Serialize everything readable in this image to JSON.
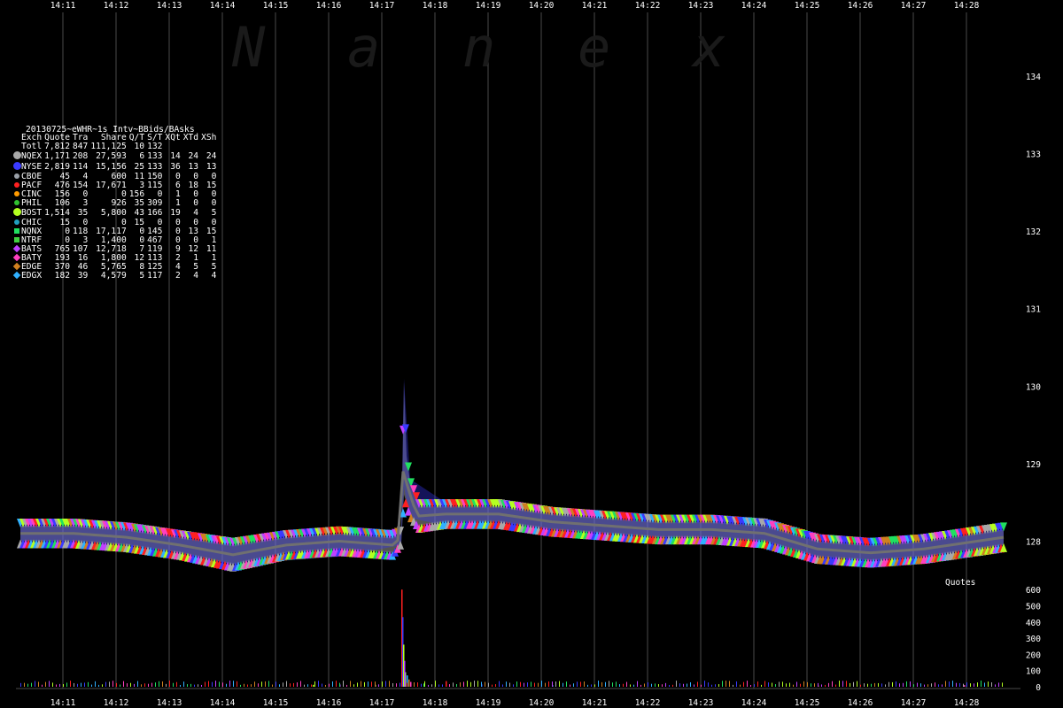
{
  "watermark": [
    "N",
    "a",
    "n",
    "e",
    "x"
  ],
  "legend": {
    "title": "20130725~eWHR~1s Intv~BBids/BAsks",
    "columns": [
      "Exch",
      "Quote",
      "Tra",
      "Share",
      "Q/T",
      "S/T",
      "XQt",
      "XTd",
      "XSh"
    ],
    "total": {
      "exch": "Totl",
      "quote": "7,812",
      "tra": "847",
      "share": "111,125",
      "qt": "10",
      "st": "132",
      "xqt": "",
      "xtd": "",
      "xsh": ""
    },
    "rows": [
      {
        "exch": "NQEX",
        "quote": "1,171",
        "tra": "208",
        "share": "27,593",
        "qt": "6",
        "st": "133",
        "xqt": "14",
        "xtd": "24",
        "xsh": "24",
        "color": "#a8a8a8",
        "marker": "dot-big"
      },
      {
        "exch": "NYSE",
        "quote": "2,819",
        "tra": "114",
        "share": "15,156",
        "qt": "25",
        "st": "133",
        "xqt": "36",
        "xtd": "13",
        "xsh": "13",
        "color": "#3a3aff",
        "marker": "dot-big"
      },
      {
        "exch": "CBOE",
        "quote": "45",
        "tra": "4",
        "share": "600",
        "qt": "11",
        "st": "150",
        "xqt": "0",
        "xtd": "0",
        "xsh": "0",
        "color": "#9aa0a8",
        "marker": "dot"
      },
      {
        "exch": "PACF",
        "quote": "476",
        "tra": "154",
        "share": "17,671",
        "qt": "3",
        "st": "115",
        "xqt": "6",
        "xtd": "18",
        "xsh": "15",
        "color": "#ff2020",
        "marker": "dot"
      },
      {
        "exch": "CINC",
        "quote": "156",
        "tra": "0",
        "share": "0",
        "qt": "156",
        "st": "0",
        "xqt": "1",
        "xtd": "0",
        "xsh": "0",
        "color": "#ff9a00",
        "marker": "dot"
      },
      {
        "exch": "PHIL",
        "quote": "106",
        "tra": "3",
        "share": "926",
        "qt": "35",
        "st": "309",
        "xqt": "1",
        "xtd": "0",
        "xsh": "0",
        "color": "#30c030",
        "marker": "dot"
      },
      {
        "exch": "BOST",
        "quote": "1,514",
        "tra": "35",
        "share": "5,800",
        "qt": "43",
        "st": "166",
        "xqt": "19",
        "xtd": "4",
        "xsh": "5",
        "color": "#b4ff20",
        "marker": "dot-big"
      },
      {
        "exch": "CHIC",
        "quote": "15",
        "tra": "0",
        "share": "0",
        "qt": "15",
        "st": "0",
        "xqt": "0",
        "xtd": "0",
        "xsh": "0",
        "color": "#20a0c0",
        "marker": "dot"
      },
      {
        "exch": "NQNX",
        "quote": "0",
        "tra": "118",
        "share": "17,117",
        "qt": "0",
        "st": "145",
        "xqt": "0",
        "xtd": "13",
        "xsh": "15",
        "color": "#20e060",
        "marker": "square"
      },
      {
        "exch": "NTRF",
        "quote": "0",
        "tra": "3",
        "share": "1,400",
        "qt": "0",
        "st": "467",
        "xqt": "0",
        "xtd": "0",
        "xsh": "1",
        "color": "#40d040",
        "marker": "square"
      },
      {
        "exch": "BATS",
        "quote": "765",
        "tra": "107",
        "share": "12,718",
        "qt": "7",
        "st": "119",
        "xqt": "9",
        "xtd": "12",
        "xsh": "11",
        "color": "#c040ff",
        "marker": "diamond"
      },
      {
        "exch": "BATY",
        "quote": "193",
        "tra": "16",
        "share": "1,800",
        "qt": "12",
        "st": "113",
        "xqt": "2",
        "xtd": "1",
        "xsh": "1",
        "color": "#ff40c0",
        "marker": "diamond"
      },
      {
        "exch": "EDGE",
        "quote": "370",
        "tra": "46",
        "share": "5,765",
        "qt": "8",
        "st": "125",
        "xqt": "4",
        "xtd": "5",
        "xsh": "5",
        "color": "#d08020",
        "marker": "diamond"
      },
      {
        "exch": "EDGX",
        "quote": "182",
        "tra": "39",
        "share": "4,579",
        "qt": "5",
        "st": "117",
        "xqt": "2",
        "xtd": "4",
        "xsh": "4",
        "color": "#30b0ff",
        "marker": "diamond"
      }
    ]
  },
  "colors": {
    "background": "#000000",
    "grid": "#4a4a4a",
    "text": "#ffffff",
    "nbbo": "#707070"
  },
  "chart_data": [
    {
      "type": "line",
      "x_ticks": [
        "14:11",
        "14:12",
        "14:13",
        "14:14",
        "14:15",
        "14:16",
        "14:17",
        "14:18",
        "14:19",
        "14:20",
        "14:21",
        "14:22",
        "14:23",
        "14:24",
        "14:25",
        "14:26",
        "14:27",
        "14:28"
      ],
      "xlim": [
        "14:10:12",
        "14:28:54"
      ],
      "y_ticks": [
        128,
        129,
        130,
        131,
        132,
        133,
        134
      ],
      "ylim": [
        127.6,
        134.3
      ],
      "grid": true,
      "series": [
        {
          "name": "NQEX",
          "color": "#a8a8a8",
          "bid": [
            [
              0,
              128.0
            ],
            [
              60,
              128.0
            ],
            [
              120,
              127.95
            ],
            [
              180,
              127.85
            ],
            [
              240,
              127.7
            ],
            [
              300,
              127.85
            ],
            [
              360,
              127.9
            ],
            [
              420,
              127.85
            ],
            [
              430,
              128.0
            ],
            [
              433,
              128.6
            ],
            [
              440,
              128.35
            ],
            [
              450,
              128.2
            ],
            [
              480,
              128.25
            ],
            [
              540,
              128.25
            ],
            [
              600,
              128.15
            ],
            [
              660,
              128.1
            ],
            [
              720,
              128.05
            ],
            [
              780,
              128.05
            ],
            [
              840,
              128.0
            ],
            [
              900,
              127.8
            ],
            [
              960,
              127.75
            ],
            [
              1020,
              127.8
            ],
            [
              1080,
              127.9
            ],
            [
              1110,
              127.95
            ]
          ],
          "ask": [
            [
              0,
              128.2
            ],
            [
              60,
              128.2
            ],
            [
              120,
              128.15
            ],
            [
              180,
              128.05
            ],
            [
              240,
              127.95
            ],
            [
              300,
              128.05
            ],
            [
              360,
              128.1
            ],
            [
              420,
              128.05
            ],
            [
              430,
              128.1
            ],
            [
              433,
              130.05
            ],
            [
              436,
              129.1
            ],
            [
              440,
              128.75
            ],
            [
              450,
              128.45
            ],
            [
              480,
              128.45
            ],
            [
              540,
              128.45
            ],
            [
              600,
              128.35
            ],
            [
              660,
              128.3
            ],
            [
              720,
              128.25
            ],
            [
              780,
              128.25
            ],
            [
              840,
              128.2
            ],
            [
              900,
              128.0
            ],
            [
              960,
              127.95
            ],
            [
              1020,
              128.0
            ],
            [
              1080,
              128.1
            ],
            [
              1110,
              128.15
            ]
          ]
        },
        {
          "name": "NYSE",
          "color": "#3a3aff",
          "bid": [
            [
              0,
              127.95
            ],
            [
              120,
              127.9
            ],
            [
              240,
              127.7
            ],
            [
              360,
              127.8
            ],
            [
              430,
              127.95
            ],
            [
              433,
              128.7
            ],
            [
              440,
              128.3
            ],
            [
              480,
              128.2
            ],
            [
              600,
              128.1
            ],
            [
              720,
              128.0
            ],
            [
              840,
              127.95
            ],
            [
              900,
              127.75
            ],
            [
              960,
              127.7
            ],
            [
              1080,
              127.85
            ],
            [
              1110,
              127.9
            ]
          ],
          "ask": [
            [
              0,
              128.25
            ],
            [
              120,
              128.2
            ],
            [
              240,
              128.0
            ],
            [
              360,
              128.1
            ],
            [
              430,
              128.15
            ],
            [
              433,
              130.1
            ],
            [
              440,
              128.8
            ],
            [
              480,
              128.5
            ],
            [
              600,
              128.4
            ],
            [
              720,
              128.3
            ],
            [
              840,
              128.25
            ],
            [
              900,
              128.05
            ],
            [
              960,
              128.0
            ],
            [
              1080,
              128.15
            ],
            [
              1110,
              128.2
            ]
          ]
        }
      ]
    },
    {
      "type": "bar",
      "y_ticks": [
        0,
        100,
        200,
        300,
        400,
        500,
        600
      ],
      "ylim": [
        0,
        660
      ],
      "label": "Quotes",
      "peak": {
        "x": "14:18:01",
        "value": 600
      },
      "values": [
        [
          430,
          600
        ],
        [
          431,
          430
        ],
        [
          432,
          260
        ],
        [
          433,
          160
        ],
        [
          434,
          90
        ],
        [
          436,
          70
        ],
        [
          438,
          45
        ],
        [
          440,
          30
        ],
        [
          455,
          20
        ],
        [
          480,
          35
        ],
        [
          520,
          15
        ],
        [
          330,
          12
        ],
        [
          360,
          14
        ],
        [
          400,
          12
        ],
        [
          600,
          10
        ],
        [
          900,
          8
        ],
        [
          1065,
          10
        ]
      ]
    }
  ]
}
